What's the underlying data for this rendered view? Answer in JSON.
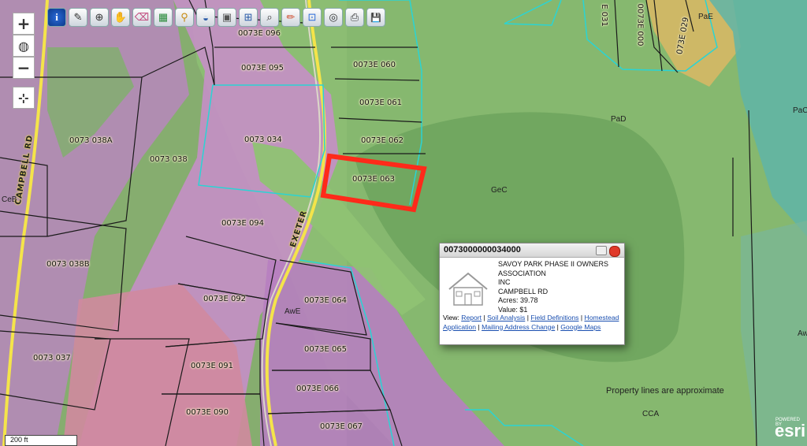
{
  "toolbar": {
    "tools": [
      {
        "name": "identify-tool",
        "glyph": "i"
      },
      {
        "name": "map-tips-tool",
        "glyph": "✎"
      },
      {
        "name": "zoom-box-tool",
        "glyph": "⊕"
      },
      {
        "name": "pan-hand-tool",
        "glyph": "✋"
      },
      {
        "name": "erase-tool",
        "glyph": "⌫"
      },
      {
        "name": "select-parcels-tool",
        "glyph": "▦"
      },
      {
        "name": "street-view-tool",
        "glyph": "⚲"
      },
      {
        "name": "basemap-tool",
        "glyph": "◒"
      },
      {
        "name": "imagery-tool",
        "glyph": "▣"
      },
      {
        "name": "buffer-tool",
        "glyph": "⊞"
      },
      {
        "name": "search-tool",
        "glyph": "⌕"
      },
      {
        "name": "draw-tool",
        "glyph": "✏"
      },
      {
        "name": "measure-tool",
        "glyph": "⊡"
      },
      {
        "name": "layers-tool",
        "glyph": "◎"
      },
      {
        "name": "print-tool",
        "glyph": "⎙"
      },
      {
        "name": "save-tool",
        "glyph": "💾"
      }
    ]
  },
  "zoom": {
    "in": "+",
    "globe": "◍",
    "out": "−",
    "locate": "⊹"
  },
  "parcels": [
    {
      "id": "0073E 096"
    },
    {
      "id": "0073E 095"
    },
    {
      "id": "0073E 060"
    },
    {
      "id": "0073E 061"
    },
    {
      "id": "0073E 062"
    },
    {
      "id": "0073E 063"
    },
    {
      "id": "0073 034"
    },
    {
      "id": "0073 038A"
    },
    {
      "id": "0073 038"
    },
    {
      "id": "0073E 094"
    },
    {
      "id": "0073 038B"
    },
    {
      "id": "0073E 092"
    },
    {
      "id": "0073E 064"
    },
    {
      "id": "0073E 091"
    },
    {
      "id": "0073E 065"
    },
    {
      "id": "0073 037"
    },
    {
      "id": "0073E 066"
    },
    {
      "id": "0073E 090"
    },
    {
      "id": "0073E 067"
    }
  ],
  "rotated_parcels": [
    {
      "id": "E 031"
    },
    {
      "id": "0073E 000"
    },
    {
      "id": "073E 029"
    }
  ],
  "soils": [
    "PaE",
    "PaD",
    "GeC",
    "CCA",
    "AwE",
    "PaC",
    "CeB",
    "Aw"
  ],
  "roads": {
    "campbell": "CAMPBELL RD",
    "exeter": "EXETER"
  },
  "popup": {
    "title": "0073000000034000",
    "owner_line1": "SAVOY PARK PHASE II OWNERS",
    "owner_line2": "ASSOCIATION",
    "owner_line3": "INC",
    "address": "CAMPBELL RD",
    "acres": "Acres: 39.78",
    "value": "Value: $1",
    "view_label": "View:",
    "links": [
      "Report",
      "Soil Analysis",
      "Field Definitions",
      "Homestead Application",
      "Mailing Address Change",
      "Google Maps"
    ]
  },
  "approx_note": "Property lines are approximate",
  "scale": "200 ft",
  "attribution": {
    "powered": "POWERED BY",
    "brand": "esri"
  },
  "colors": {
    "highlight": "#ff2a1a",
    "parcel_line": "#1a1a1a",
    "soil_line": "#2ad4d4",
    "road": "#f4e44a"
  }
}
